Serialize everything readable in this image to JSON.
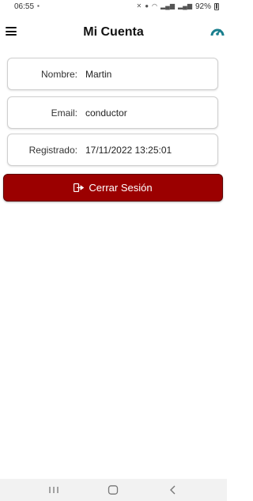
{
  "status_bar": {
    "time": "06:55",
    "battery": "92%"
  },
  "header": {
    "title": "Mi Cuenta"
  },
  "account": {
    "fields": [
      {
        "label": "Nombre:",
        "value": "Martin"
      },
      {
        "label": "Email:",
        "value": "conductor"
      },
      {
        "label": "Registrado:",
        "value": "17/11/2022 13:25:01"
      }
    ]
  },
  "logout": {
    "label": "Cerrar Sesión",
    "color": "#9b0000"
  },
  "icons": {
    "menu": "menu-icon",
    "gauge": "gauge-icon",
    "logout": "sign-out-icon",
    "nav": [
      "recent-apps-icon",
      "home-icon",
      "back-icon"
    ]
  },
  "colors": {
    "accent": "#1a7f8e",
    "danger": "#9b0000"
  }
}
